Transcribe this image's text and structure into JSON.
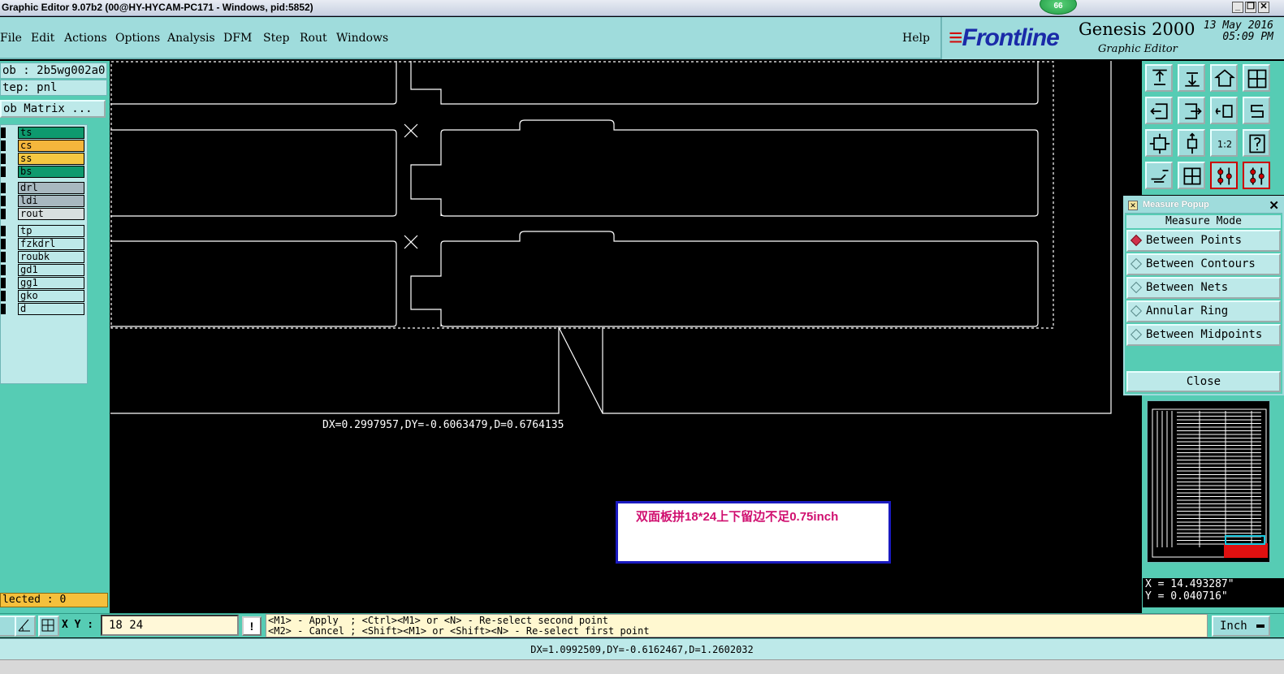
{
  "window": {
    "title": "Graphic Editor 9.07b2 (00@HY-HYCAM-PC171 - Windows, pid:5852)",
    "badge": "66",
    "minimize": "_",
    "restore": "❐",
    "close": "✕"
  },
  "menu": {
    "items": [
      "File",
      "Edit",
      "Actions",
      "Options",
      "Analysis",
      "DFM",
      "Step",
      "Rout",
      "Windows"
    ],
    "help": "Help"
  },
  "brand": {
    "logo": "Frontline",
    "product": "Genesis 2000",
    "subtitle": "Graphic Editor",
    "date": "13 May 2016",
    "time": "05:09 PM"
  },
  "left": {
    "job": "ob : 2b5wg002a0",
    "step": "tep: pnl",
    "matrix_button": "ob Matrix ...",
    "layers": [
      {
        "name": "ts",
        "color": "#0e9a6e"
      },
      {
        "name": "cs",
        "color": "#f5b63c"
      },
      {
        "name": "ss",
        "color": "#f5c842"
      },
      {
        "name": "bs",
        "color": "#0e9a6e"
      },
      {
        "name": "drl",
        "color": "#a8b8c0"
      },
      {
        "name": "ldi",
        "color": "#a8b8c0"
      },
      {
        "name": "rout",
        "color": "#d8e0e0"
      },
      {
        "name": "tp",
        "color": "#bde9e9"
      },
      {
        "name": "fzkdrl",
        "color": "#bde9e9"
      },
      {
        "name": "roubk",
        "color": "#bde9e9"
      },
      {
        "name": "gd1",
        "color": "#bde9e9"
      },
      {
        "name": "gg1",
        "color": "#bde9e9"
      },
      {
        "name": "gko",
        "color": "#bde9e9"
      },
      {
        "name": "d",
        "color": "#bde9e9"
      }
    ],
    "selected": "lected : 0"
  },
  "canvas": {
    "readout": "DX=0.2997957,DY=-0.6063479,D=0.6764135",
    "note": "双面板拼18*24上下留边不足0.75inch"
  },
  "toolbar": {
    "icons": [
      "snap-up-icon",
      "snap-down-icon",
      "home-icon",
      "window-icon",
      "move-left-icon",
      "move-right-icon",
      "undo-view-icon",
      "redraw-icon",
      "fit-all-icon",
      "fit-zoom-icon",
      "ratio-icon",
      "help-icon",
      "wrench-icon",
      "grid-icon",
      "net-a-icon",
      "net-b-icon"
    ],
    "ratio_label": "1:2"
  },
  "measure": {
    "title": "Measure Popup",
    "mode_label": "Measure Mode",
    "options": [
      {
        "label": "Between Points",
        "selected": true
      },
      {
        "label": "Between Contours",
        "selected": false
      },
      {
        "label": "Between Nets",
        "selected": false
      },
      {
        "label": "Annular Ring",
        "selected": false
      },
      {
        "label": "Between Midpoints",
        "selected": false
      }
    ],
    "close_label": "Close"
  },
  "coords": {
    "x": "X = 14.493287\"",
    "y": "Y = 0.040716\""
  },
  "bottom": {
    "xy_label": "X Y :",
    "xy_value": "18 24",
    "bang": "!",
    "hint_line1": "<M1> - Apply  ; <Ctrl><M1> or <N> - Re-select second point",
    "hint_line2": "<M2> - Cancel ; <Shift><M1> or <Shift><N> - Re-select first point",
    "unit": "Inch"
  },
  "status": {
    "text": "DX=1.0992509,DY=-0.6162467,D=1.2602032"
  }
}
